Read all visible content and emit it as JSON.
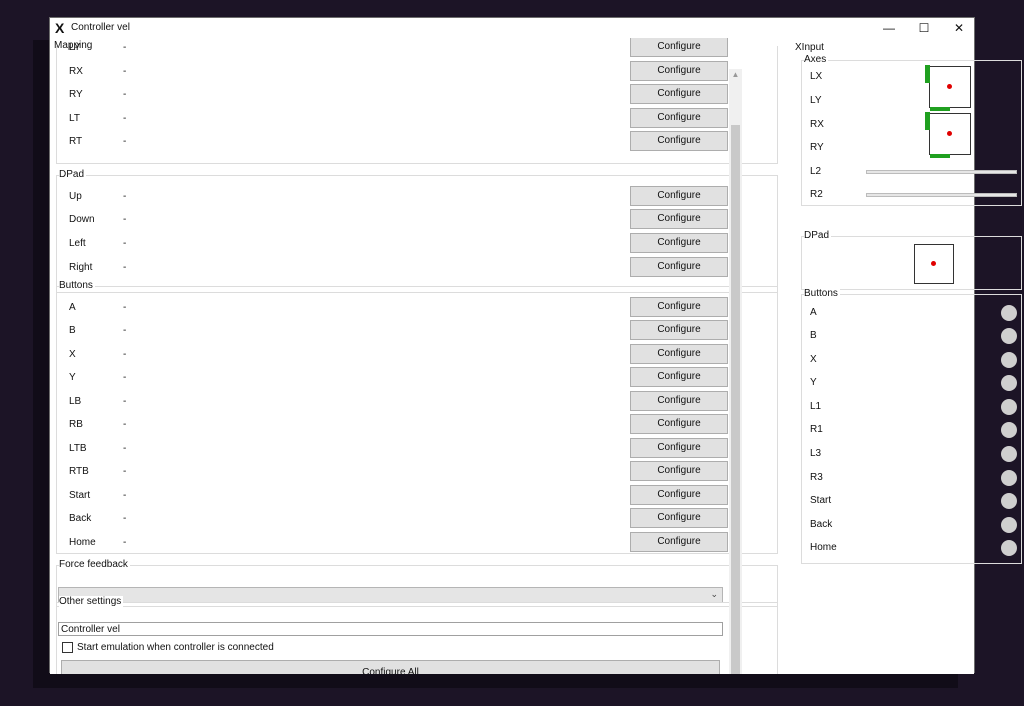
{
  "window": {
    "title": "Controller vel",
    "icon": "X",
    "minimize_glyph": "—",
    "maximize_glyph": "☐",
    "close_glyph": "✕"
  },
  "mapping": {
    "label": "Mapping",
    "rows": [
      {
        "name": "LY",
        "value": "-",
        "button": "Configure"
      },
      {
        "name": "RX",
        "value": "-",
        "button": "Configure"
      },
      {
        "name": "RY",
        "value": "-",
        "button": "Configure"
      },
      {
        "name": "LT",
        "value": "-",
        "button": "Configure"
      },
      {
        "name": "RT",
        "value": "-",
        "button": "Configure"
      }
    ]
  },
  "dpad": {
    "label": "DPad",
    "rows": [
      {
        "name": "Up",
        "value": "-",
        "button": "Configure"
      },
      {
        "name": "Down",
        "value": "-",
        "button": "Configure"
      },
      {
        "name": "Left",
        "value": "-",
        "button": "Configure"
      },
      {
        "name": "Right",
        "value": "-",
        "button": "Configure"
      }
    ]
  },
  "buttons": {
    "label": "Buttons",
    "rows": [
      {
        "name": "A",
        "value": "-",
        "button": "Configure"
      },
      {
        "name": "B",
        "value": "-",
        "button": "Configure"
      },
      {
        "name": "X",
        "value": "-",
        "button": "Configure"
      },
      {
        "name": "Y",
        "value": "-",
        "button": "Configure"
      },
      {
        "name": "LB",
        "value": "-",
        "button": "Configure"
      },
      {
        "name": "RB",
        "value": "-",
        "button": "Configure"
      },
      {
        "name": "LTB",
        "value": "-",
        "button": "Configure"
      },
      {
        "name": "RTB",
        "value": "-",
        "button": "Configure"
      },
      {
        "name": "Start",
        "value": "-",
        "button": "Configure"
      },
      {
        "name": "Back",
        "value": "-",
        "button": "Configure"
      },
      {
        "name": "Home",
        "value": "-",
        "button": "Configure"
      }
    ]
  },
  "force_feedback": {
    "label": "Force feedback",
    "selected": "",
    "arrow": "⌄"
  },
  "other_settings": {
    "label": "Other settings",
    "name_value": "Controller vel",
    "checkbox_label": "Start emulation when controller is connected",
    "checkbox_checked": false,
    "configure_all": "Configure All"
  },
  "scrollbar": {
    "up": "▲",
    "down": "▼"
  },
  "xinput": {
    "label": "XInput",
    "axes": {
      "label": "Axes",
      "names": [
        "LX",
        "LY",
        "RX",
        "RY",
        "L2",
        "R2"
      ]
    },
    "dpad": {
      "label": "DPad"
    },
    "buttons": {
      "label": "Buttons",
      "names": [
        "A",
        "B",
        "X",
        "Y",
        "L1",
        "R1",
        "L3",
        "R3",
        "Start",
        "Back",
        "Home"
      ]
    }
  },
  "colors": {
    "indicator_green": "#20a020",
    "indicator_dot": "#e00000",
    "led_off": "#cfcfcf",
    "desktop": "#1c1426"
  }
}
